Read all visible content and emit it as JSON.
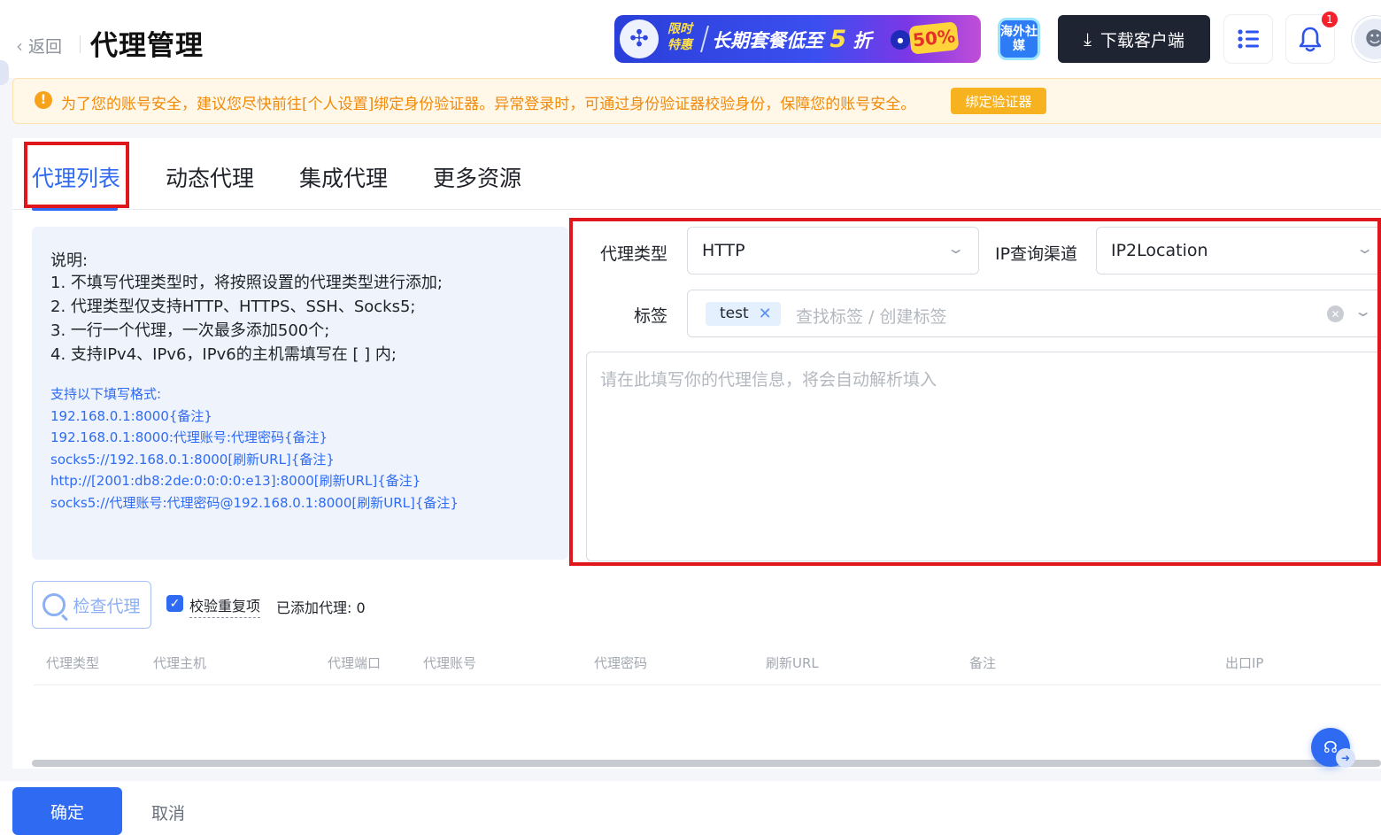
{
  "header": {
    "back_label": "返回",
    "title": "代理管理",
    "promo": {
      "tag": "限时特惠",
      "text_prefix": "长期套餐低至",
      "discount_num": "5",
      "discount_unit": "折",
      "badge": "50%"
    },
    "overseas_label": "海外社媒",
    "download_label": "下载客户端",
    "notification_count": "1"
  },
  "warning": {
    "text": "为了您的账号安全，建议您尽快前往[个人设置]绑定身份验证器。异常登录时，可通过身份验证器校验身份，保障您的账号安全。",
    "button": "绑定验证器"
  },
  "tabs": [
    {
      "label": "代理列表",
      "active": true
    },
    {
      "label": "动态代理",
      "active": false
    },
    {
      "label": "集成代理",
      "active": false
    },
    {
      "label": "更多资源",
      "active": false
    }
  ],
  "help": {
    "title": "说明:",
    "rules": [
      "1. 不填写代理类型时，将按照设置的代理类型进行添加;",
      "2. 代理类型仅支持HTTP、HTTPS、SSH、Socks5;",
      "3. 一行一个代理，一次最多添加500个;",
      "4. 支持IPv4、IPv6，IPv6的主机需填写在 [ ] 内;"
    ],
    "formats_title": "支持以下填写格式:",
    "formats": [
      "192.168.0.1:8000{备注}",
      "192.168.0.1:8000:代理账号:代理密码{备注}",
      "socks5://192.168.0.1:8000[刷新URL]{备注}",
      "http://[2001:db8:2de:0:0:0:0:e13]:8000[刷新URL]{备注}",
      "socks5://代理账号:代理密码@192.168.0.1:8000[刷新URL]{备注}"
    ]
  },
  "form": {
    "proxy_type_label": "代理类型",
    "proxy_type_value": "HTTP",
    "ip_channel_label": "IP查询渠道",
    "ip_channel_value": "IP2Location",
    "tag_label": "标签",
    "tag_value": "test",
    "tag_placeholder": "查找标签 / 创建标签",
    "textarea_placeholder": "请在此填写你的代理信息，将会自动解析填入"
  },
  "actions": {
    "check_label": "检查代理",
    "dedupe_label": "校验重复项",
    "dedupe_checked": true,
    "added_label": "已添加代理:",
    "added_count": "0"
  },
  "table": {
    "columns": [
      "代理类型",
      "代理主机",
      "代理端口",
      "代理账号",
      "代理密码",
      "刷新URL",
      "备注",
      "出口IP"
    ]
  },
  "footer": {
    "ok": "确定",
    "cancel": "取消"
  },
  "colors": {
    "primary": "#2f6bf2",
    "warning": "#f08a0a",
    "highlight": "#e0161d"
  }
}
